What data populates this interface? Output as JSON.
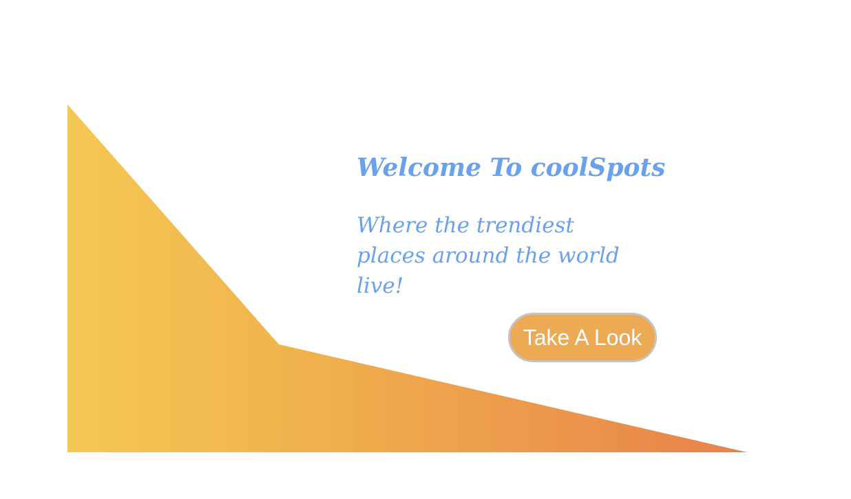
{
  "hero": {
    "title": "Welcome To coolSpots",
    "subtitle": "Where the trendiest places around the world live!",
    "cta_label": "Take A Look"
  },
  "colors": {
    "text": "#6aa1ec",
    "button_bg": "#ecaa55",
    "button_border": "#c4c4c4",
    "gradient_start": "#f5c853",
    "gradient_end": "#e8814a"
  }
}
